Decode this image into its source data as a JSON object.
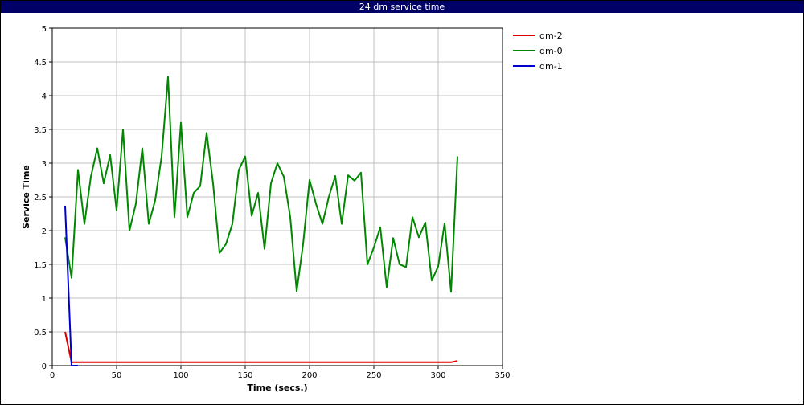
{
  "window": {
    "title": "24 dm service time",
    "title_bg": "#000066"
  },
  "chart_data": {
    "type": "line",
    "title": "24 dm service time",
    "xlabel": "Time (secs.)",
    "ylabel": "Service Time",
    "xlim": [
      0,
      350
    ],
    "ylim": [
      0,
      5
    ],
    "xticks": [
      0,
      50,
      100,
      150,
      200,
      250,
      300,
      350
    ],
    "yticks": [
      0,
      0.5,
      1,
      1.5,
      2,
      2.5,
      3,
      3.5,
      4,
      4.5,
      5
    ],
    "grid": true,
    "legend_position": "right",
    "series": [
      {
        "name": "dm-2",
        "color": "#dd0000",
        "x": [
          10,
          15,
          20,
          300,
          310,
          315
        ],
        "y": [
          0.5,
          0.05,
          0.05,
          0.05,
          0.05,
          0.07
        ]
      },
      {
        "name": "dm-0",
        "color": "#008800",
        "x": [
          10,
          15,
          20,
          25,
          30,
          35,
          40,
          45,
          50,
          55,
          60,
          65,
          70,
          75,
          80,
          85,
          90,
          95,
          100,
          105,
          110,
          115,
          120,
          125,
          130,
          135,
          140,
          145,
          150,
          155,
          160,
          165,
          170,
          175,
          180,
          185,
          190,
          195,
          200,
          205,
          210,
          215,
          220,
          225,
          230,
          235,
          240,
          245,
          250,
          255,
          260,
          265,
          270,
          275,
          280,
          285,
          290,
          295,
          300,
          305,
          310,
          315
        ],
        "y": [
          1.9,
          1.3,
          2.9,
          2.1,
          2.8,
          3.22,
          2.7,
          3.12,
          2.3,
          3.5,
          2.0,
          2.4,
          3.22,
          2.1,
          2.45,
          3.1,
          4.28,
          2.2,
          3.6,
          2.2,
          2.56,
          2.66,
          3.45,
          2.7,
          1.67,
          1.8,
          2.1,
          2.9,
          3.1,
          2.22,
          2.56,
          1.73,
          2.7,
          3.0,
          2.8,
          2.2,
          1.1,
          1.8,
          2.75,
          2.4,
          2.1,
          2.5,
          2.81,
          2.1,
          2.82,
          2.74,
          2.86,
          1.5,
          1.75,
          2.05,
          1.16,
          1.89,
          1.5,
          1.46,
          2.2,
          1.9,
          2.12,
          1.26,
          1.47,
          2.11,
          1.09,
          3.1
        ]
      },
      {
        "name": "dm-1",
        "color": "#0000cc",
        "x": [
          10,
          15,
          20
        ],
        "y": [
          2.37,
          0.0,
          0.0
        ]
      }
    ]
  }
}
